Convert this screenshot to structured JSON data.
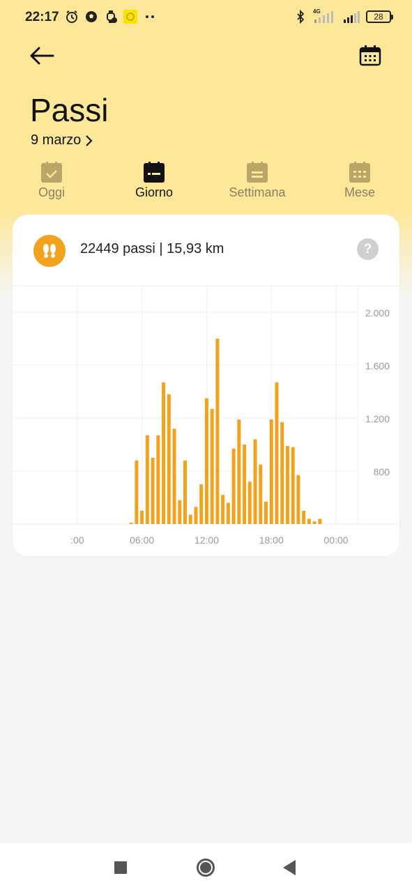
{
  "status_bar": {
    "time": "22:17",
    "network": "4G",
    "battery": "28"
  },
  "header": {
    "title": "Passi",
    "date": "9 marzo"
  },
  "tabs": [
    {
      "label": "Oggi",
      "icon": "calendar-check-icon",
      "active": false
    },
    {
      "label": "Giorno",
      "icon": "calendar-day-icon",
      "active": true
    },
    {
      "label": "Settimana",
      "icon": "calendar-week-icon",
      "active": false
    },
    {
      "label": "Mese",
      "icon": "calendar-month-icon",
      "active": false
    }
  ],
  "summary": {
    "text": "22449 passi | 15,93 km",
    "icon": "footprints-icon",
    "help": "?"
  },
  "colors": {
    "accent": "#f3a21d",
    "header_bg": "#fde899",
    "tab_inactive": "#8a7f62"
  },
  "chart_data": {
    "type": "bar",
    "x_tick_labels": [
      ":00",
      "06:00",
      "12:00",
      "18:00",
      "00:00"
    ],
    "y_tick_labels": [
      "2.000",
      "1.600",
      "1.200",
      "800"
    ],
    "y_ticks": [
      2000,
      1600,
      1200,
      800
    ],
    "ylim": [
      400,
      2200
    ],
    "x_range_hours": [
      -6,
      26
    ],
    "grid": true,
    "bar_color": "#f3a21d",
    "bars": [
      {
        "hour": 5.0,
        "value": 410
      },
      {
        "hour": 5.5,
        "value": 880
      },
      {
        "hour": 6.0,
        "value": 500
      },
      {
        "hour": 6.5,
        "value": 1070
      },
      {
        "hour": 7.0,
        "value": 900
      },
      {
        "hour": 7.5,
        "value": 1070
      },
      {
        "hour": 8.0,
        "value": 1470
      },
      {
        "hour": 8.5,
        "value": 1380
      },
      {
        "hour": 9.0,
        "value": 1120
      },
      {
        "hour": 9.5,
        "value": 580
      },
      {
        "hour": 10.0,
        "value": 880
      },
      {
        "hour": 10.5,
        "value": 470
      },
      {
        "hour": 11.0,
        "value": 530
      },
      {
        "hour": 11.5,
        "value": 700
      },
      {
        "hour": 12.0,
        "value": 1350
      },
      {
        "hour": 12.5,
        "value": 1270
      },
      {
        "hour": 13.0,
        "value": 1800
      },
      {
        "hour": 13.5,
        "value": 620
      },
      {
        "hour": 14.0,
        "value": 560
      },
      {
        "hour": 14.5,
        "value": 970
      },
      {
        "hour": 15.0,
        "value": 1190
      },
      {
        "hour": 15.5,
        "value": 1000
      },
      {
        "hour": 16.0,
        "value": 720
      },
      {
        "hour": 16.5,
        "value": 1040
      },
      {
        "hour": 17.0,
        "value": 850
      },
      {
        "hour": 17.5,
        "value": 570
      },
      {
        "hour": 18.0,
        "value": 1190
      },
      {
        "hour": 18.5,
        "value": 1470
      },
      {
        "hour": 19.0,
        "value": 1170
      },
      {
        "hour": 19.5,
        "value": 990
      },
      {
        "hour": 20.0,
        "value": 980
      },
      {
        "hour": 20.5,
        "value": 770
      },
      {
        "hour": 21.0,
        "value": 500
      },
      {
        "hour": 21.5,
        "value": 440
      },
      {
        "hour": 22.0,
        "value": 420
      },
      {
        "hour": 22.5,
        "value": 440
      }
    ]
  }
}
